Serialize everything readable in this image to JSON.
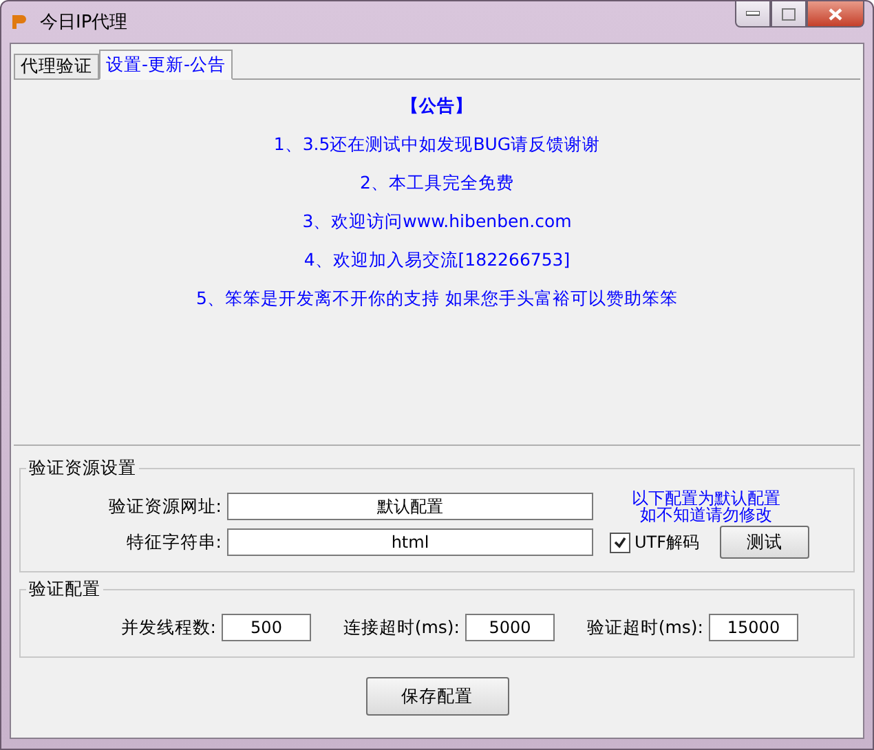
{
  "window": {
    "title": "今日IP代理"
  },
  "tabs": [
    {
      "label": "代理验证",
      "selected": false
    },
    {
      "label": "设置-更新-公告",
      "selected": true
    }
  ],
  "notice": {
    "heading": "【公告】",
    "lines": [
      "1、3.5还在测试中如发现BUG请反馈谢谢",
      "2、本工具完全免费",
      "3、欢迎访问www.hibenben.com",
      "4、欢迎加入易交流[182266753]",
      "5、笨笨是开发离不开你的支持 如果您手头富裕可以赞助笨笨"
    ]
  },
  "source_group": {
    "title": "验证资源设置",
    "url_label": "验证资源网址:",
    "url_value": "默认配置",
    "hint": [
      "以下配置为默认配置",
      "如不知道请勿修改"
    ],
    "keyword_label": "特征字符串:",
    "keyword_value": "html",
    "utf": {
      "label": "UTF解码",
      "checked": true
    },
    "test_button": "测试"
  },
  "verify_group": {
    "title": "验证配置",
    "fields": [
      {
        "label": "并发线程数:",
        "value": "500"
      },
      {
        "label": "连接超时(ms):",
        "value": "5000"
      },
      {
        "label": "验证超时(ms):",
        "value": "15000"
      }
    ]
  },
  "save_button": "保存配置"
}
